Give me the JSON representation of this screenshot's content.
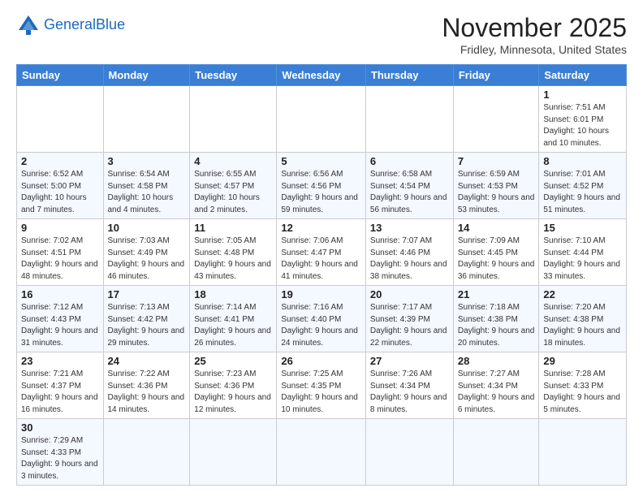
{
  "header": {
    "logo_line1": "General",
    "logo_line2": "Blue",
    "month": "November 2025",
    "location": "Fridley, Minnesota, United States"
  },
  "weekdays": [
    "Sunday",
    "Monday",
    "Tuesday",
    "Wednesday",
    "Thursday",
    "Friday",
    "Saturday"
  ],
  "weeks": [
    [
      {
        "day": "",
        "info": ""
      },
      {
        "day": "",
        "info": ""
      },
      {
        "day": "",
        "info": ""
      },
      {
        "day": "",
        "info": ""
      },
      {
        "day": "",
        "info": ""
      },
      {
        "day": "",
        "info": ""
      },
      {
        "day": "1",
        "info": "Sunrise: 7:51 AM\nSunset: 6:01 PM\nDaylight: 10 hours and 10 minutes."
      }
    ],
    [
      {
        "day": "2",
        "info": "Sunrise: 6:52 AM\nSunset: 5:00 PM\nDaylight: 10 hours and 7 minutes."
      },
      {
        "day": "3",
        "info": "Sunrise: 6:54 AM\nSunset: 4:58 PM\nDaylight: 10 hours and 4 minutes."
      },
      {
        "day": "4",
        "info": "Sunrise: 6:55 AM\nSunset: 4:57 PM\nDaylight: 10 hours and 2 minutes."
      },
      {
        "day": "5",
        "info": "Sunrise: 6:56 AM\nSunset: 4:56 PM\nDaylight: 9 hours and 59 minutes."
      },
      {
        "day": "6",
        "info": "Sunrise: 6:58 AM\nSunset: 4:54 PM\nDaylight: 9 hours and 56 minutes."
      },
      {
        "day": "7",
        "info": "Sunrise: 6:59 AM\nSunset: 4:53 PM\nDaylight: 9 hours and 53 minutes."
      },
      {
        "day": "8",
        "info": "Sunrise: 7:01 AM\nSunset: 4:52 PM\nDaylight: 9 hours and 51 minutes."
      }
    ],
    [
      {
        "day": "9",
        "info": "Sunrise: 7:02 AM\nSunset: 4:51 PM\nDaylight: 9 hours and 48 minutes."
      },
      {
        "day": "10",
        "info": "Sunrise: 7:03 AM\nSunset: 4:49 PM\nDaylight: 9 hours and 46 minutes."
      },
      {
        "day": "11",
        "info": "Sunrise: 7:05 AM\nSunset: 4:48 PM\nDaylight: 9 hours and 43 minutes."
      },
      {
        "day": "12",
        "info": "Sunrise: 7:06 AM\nSunset: 4:47 PM\nDaylight: 9 hours and 41 minutes."
      },
      {
        "day": "13",
        "info": "Sunrise: 7:07 AM\nSunset: 4:46 PM\nDaylight: 9 hours and 38 minutes."
      },
      {
        "day": "14",
        "info": "Sunrise: 7:09 AM\nSunset: 4:45 PM\nDaylight: 9 hours and 36 minutes."
      },
      {
        "day": "15",
        "info": "Sunrise: 7:10 AM\nSunset: 4:44 PM\nDaylight: 9 hours and 33 minutes."
      }
    ],
    [
      {
        "day": "16",
        "info": "Sunrise: 7:12 AM\nSunset: 4:43 PM\nDaylight: 9 hours and 31 minutes."
      },
      {
        "day": "17",
        "info": "Sunrise: 7:13 AM\nSunset: 4:42 PM\nDaylight: 9 hours and 29 minutes."
      },
      {
        "day": "18",
        "info": "Sunrise: 7:14 AM\nSunset: 4:41 PM\nDaylight: 9 hours and 26 minutes."
      },
      {
        "day": "19",
        "info": "Sunrise: 7:16 AM\nSunset: 4:40 PM\nDaylight: 9 hours and 24 minutes."
      },
      {
        "day": "20",
        "info": "Sunrise: 7:17 AM\nSunset: 4:39 PM\nDaylight: 9 hours and 22 minutes."
      },
      {
        "day": "21",
        "info": "Sunrise: 7:18 AM\nSunset: 4:38 PM\nDaylight: 9 hours and 20 minutes."
      },
      {
        "day": "22",
        "info": "Sunrise: 7:20 AM\nSunset: 4:38 PM\nDaylight: 9 hours and 18 minutes."
      }
    ],
    [
      {
        "day": "23",
        "info": "Sunrise: 7:21 AM\nSunset: 4:37 PM\nDaylight: 9 hours and 16 minutes."
      },
      {
        "day": "24",
        "info": "Sunrise: 7:22 AM\nSunset: 4:36 PM\nDaylight: 9 hours and 14 minutes."
      },
      {
        "day": "25",
        "info": "Sunrise: 7:23 AM\nSunset: 4:36 PM\nDaylight: 9 hours and 12 minutes."
      },
      {
        "day": "26",
        "info": "Sunrise: 7:25 AM\nSunset: 4:35 PM\nDaylight: 9 hours and 10 minutes."
      },
      {
        "day": "27",
        "info": "Sunrise: 7:26 AM\nSunset: 4:34 PM\nDaylight: 9 hours and 8 minutes."
      },
      {
        "day": "28",
        "info": "Sunrise: 7:27 AM\nSunset: 4:34 PM\nDaylight: 9 hours and 6 minutes."
      },
      {
        "day": "29",
        "info": "Sunrise: 7:28 AM\nSunset: 4:33 PM\nDaylight: 9 hours and 5 minutes."
      }
    ],
    [
      {
        "day": "30",
        "info": "Sunrise: 7:29 AM\nSunset: 4:33 PM\nDaylight: 9 hours and 3 minutes."
      },
      {
        "day": "",
        "info": ""
      },
      {
        "day": "",
        "info": ""
      },
      {
        "day": "",
        "info": ""
      },
      {
        "day": "",
        "info": ""
      },
      {
        "day": "",
        "info": ""
      },
      {
        "day": "",
        "info": ""
      }
    ]
  ]
}
